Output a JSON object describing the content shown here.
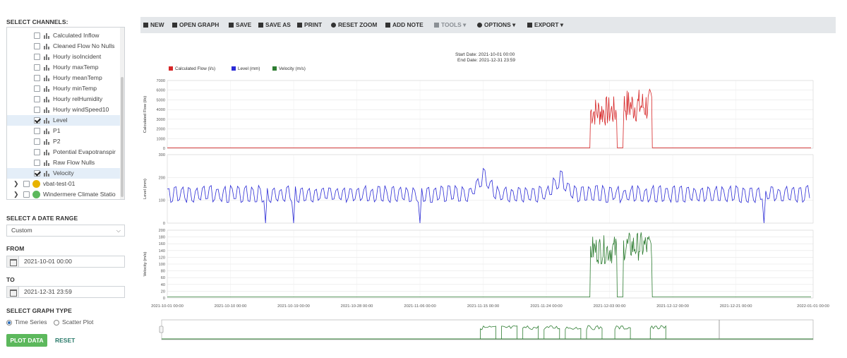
{
  "sidebar": {
    "select_channels_label": "SELECT CHANNELS:",
    "channels": [
      {
        "label": "Calculated Inflow",
        "checked": false
      },
      {
        "label": "Cleaned Flow No Nulls",
        "checked": false
      },
      {
        "label": "Hourly isoIncident",
        "checked": false
      },
      {
        "label": "Hourly maxTemp",
        "checked": false
      },
      {
        "label": "Hourly meanTemp",
        "checked": false
      },
      {
        "label": "Hourly minTemp",
        "checked": false
      },
      {
        "label": "Hourly relHumidity",
        "checked": false
      },
      {
        "label": "Hourly windSpeed10",
        "checked": false
      },
      {
        "label": "Level",
        "checked": true
      },
      {
        "label": "P1",
        "checked": false
      },
      {
        "label": "P2",
        "checked": false
      },
      {
        "label": "Potential Evapotranspir",
        "checked": false
      },
      {
        "label": "Raw Flow Nulls",
        "checked": false
      },
      {
        "label": "Velocity",
        "checked": true
      }
    ],
    "stations": [
      {
        "label": "vbat-test-01",
        "color": "#e8b400"
      },
      {
        "label": "Windermere Climate Statio",
        "color": "#5cb85c"
      }
    ],
    "date_range_label": "SELECT A DATE RANGE",
    "date_range_value": "Custom",
    "from_label": "FROM",
    "from_value": "2021-10-01 00:00",
    "to_label": "TO",
    "to_value": "2021-12-31 23:59",
    "graph_type_label": "SELECT GRAPH TYPE",
    "graph_types": [
      "Time Series",
      "Scatter Plot"
    ],
    "graph_type_selected": "Time Series",
    "plot_button": "PLOT DATA",
    "reset_button": "RESET"
  },
  "toolbar": {
    "new": "NEW",
    "open_graph": "OPEN GRAPH",
    "save": "SAVE",
    "save_as": "SAVE AS",
    "print": "PRINT",
    "reset_zoom": "RESET ZOOM",
    "add_note": "ADD NOTE",
    "tools": "TOOLS",
    "options": "OPTIONS",
    "export": "EXPORT"
  },
  "chart_data": {
    "type": "line",
    "start_date": "Start Date: 2021-10-01 00:00",
    "end_date": "End Date: 2021-12-31 23:59",
    "legend": [
      {
        "name": "Calculated Flow (l/s)",
        "color": "#d62728"
      },
      {
        "name": "Level (mm)",
        "color": "#2b2bd6"
      },
      {
        "name": "Velocity (m/s)",
        "color": "#2e7d32"
      }
    ],
    "x_ticks": [
      "2021-10-01 00:00",
      "2021-10-10 00:00",
      "2021-10-19 00:00",
      "2021-10-28 00:00",
      "2021-11-06 00:00",
      "2021-11-15 00:00",
      "2021-11-24 00:00",
      "2021-12-03 00:00",
      "2021-12-12 00:00",
      "2021-12-21 00:00",
      "2022-01-01 00:00"
    ],
    "xlim": [
      "2021-10-01 00:00",
      "2022-01-01 00:00"
    ],
    "panels": [
      {
        "ylabel": "Calculated Flow (l/s)",
        "ylim": [
          0,
          7000
        ],
        "y_ticks": [
          "0",
          "1000",
          "2000",
          "3000",
          "4000",
          "5000",
          "6000",
          "7000"
        ],
        "color": "#d62728",
        "baseline": 50,
        "active_windows": [
          {
            "start": "2021-11-30 06:00",
            "end": "2021-12-04 00:00",
            "low": 2200,
            "high": 5400
          },
          {
            "start": "2021-12-05 00:00",
            "end": "2021-12-09 00:00",
            "low": 2600,
            "high": 6200
          }
        ],
        "gaps": [
          {
            "start": "2021-12-04 00:00",
            "end": "2021-12-05 00:00",
            "value": 50
          }
        ]
      },
      {
        "ylabel": "Level (mm)",
        "ylim": [
          0,
          300
        ],
        "y_ticks": [
          "0",
          "100",
          "200",
          "300"
        ],
        "color": "#2b2bd6",
        "daily_low": 90,
        "daily_high": 165,
        "bumps": [
          {
            "date": "2021-11-15 00:00",
            "level": 245
          },
          {
            "date": "2021-11-26 00:00",
            "level": 235
          }
        ],
        "dropouts": [
          "2021-10-15 00:00",
          "2021-10-19 00:00",
          "2021-11-06 00:00",
          "2021-12-25 00:00"
        ]
      },
      {
        "ylabel": "Velocity (m/s)",
        "ylim": [
          0,
          200
        ],
        "y_ticks": [
          "0",
          "20",
          "40",
          "60",
          "80",
          "100",
          "120",
          "140",
          "160",
          "180",
          "200"
        ],
        "color": "#2e7d32",
        "baseline": 3,
        "active_windows": [
          {
            "start": "2021-11-30 06:00",
            "end": "2021-12-04 00:00",
            "low": 100,
            "high": 185
          },
          {
            "start": "2021-12-05 00:00",
            "end": "2021-12-09 00:00",
            "low": 110,
            "high": 195
          }
        ]
      }
    ],
    "navigator": {
      "color": "#2e7d32",
      "bursts": [
        "2021-11-15",
        "2021-11-18",
        "2021-11-21",
        "2021-11-24",
        "2021-11-27",
        "2021-11-30",
        "2021-12-04",
        "2021-12-09"
      ]
    }
  }
}
